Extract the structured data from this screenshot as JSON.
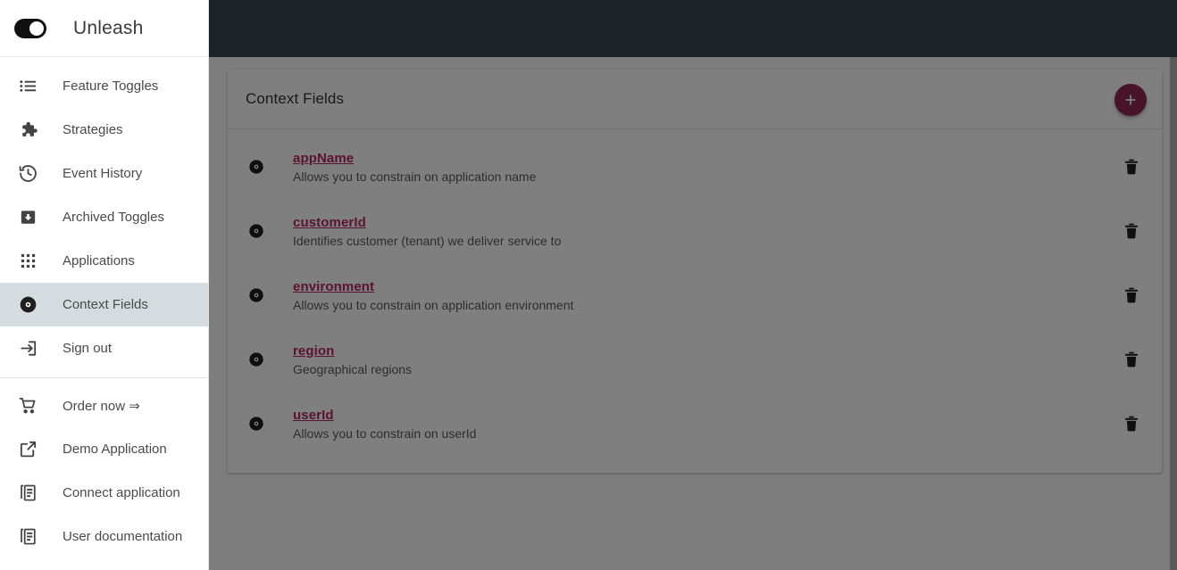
{
  "brand": {
    "name": "Unleash",
    "logo_icon": "toggle-on-icon"
  },
  "sidebar": {
    "primary_items": [
      {
        "label": "Feature Toggles",
        "icon": "list-icon",
        "active": false
      },
      {
        "label": "Strategies",
        "icon": "puzzle-icon",
        "active": false
      },
      {
        "label": "Event History",
        "icon": "history-icon",
        "active": false
      },
      {
        "label": "Archived Toggles",
        "icon": "archive-icon",
        "active": false
      },
      {
        "label": "Applications",
        "icon": "apps-grid-icon",
        "active": false
      },
      {
        "label": "Context Fields",
        "icon": "album-disc-icon",
        "active": true
      },
      {
        "label": "Sign out",
        "icon": "sign-out-icon",
        "active": false
      }
    ],
    "secondary_items": [
      {
        "label": "Order now ⇒",
        "icon": "shopping-cart-icon"
      },
      {
        "label": "Demo Application",
        "icon": "external-link-icon"
      },
      {
        "label": "Connect application",
        "icon": "documents-icon"
      },
      {
        "label": "User documentation",
        "icon": "documents-icon"
      }
    ]
  },
  "card": {
    "title": "Context Fields",
    "add_button": {
      "icon": "plus-icon",
      "aria_label": "Add context field"
    },
    "rows": [
      {
        "icon": "album-disc-icon",
        "name": "appName",
        "description": "Allows you to constrain on application name",
        "delete_icon": "trash-icon"
      },
      {
        "icon": "album-disc-icon",
        "name": "customerId",
        "description": "Identifies customer (tenant) we deliver service to",
        "delete_icon": "trash-icon"
      },
      {
        "icon": "album-disc-icon",
        "name": "environment",
        "description": "Allows you to constrain on application environment",
        "delete_icon": "trash-icon"
      },
      {
        "icon": "album-disc-icon",
        "name": "region",
        "description": "Geographical regions",
        "delete_icon": "trash-icon"
      },
      {
        "icon": "album-disc-icon",
        "name": "userId",
        "description": "Allows you to constrain on userId",
        "delete_icon": "trash-icon"
      }
    ]
  },
  "colors": {
    "topbar": "#37474f",
    "accent_link": "#b5295c",
    "fab": "#8e2852",
    "sidebar_active": "#d4dce0",
    "scrim": "rgba(0,0,0,0.5)"
  }
}
